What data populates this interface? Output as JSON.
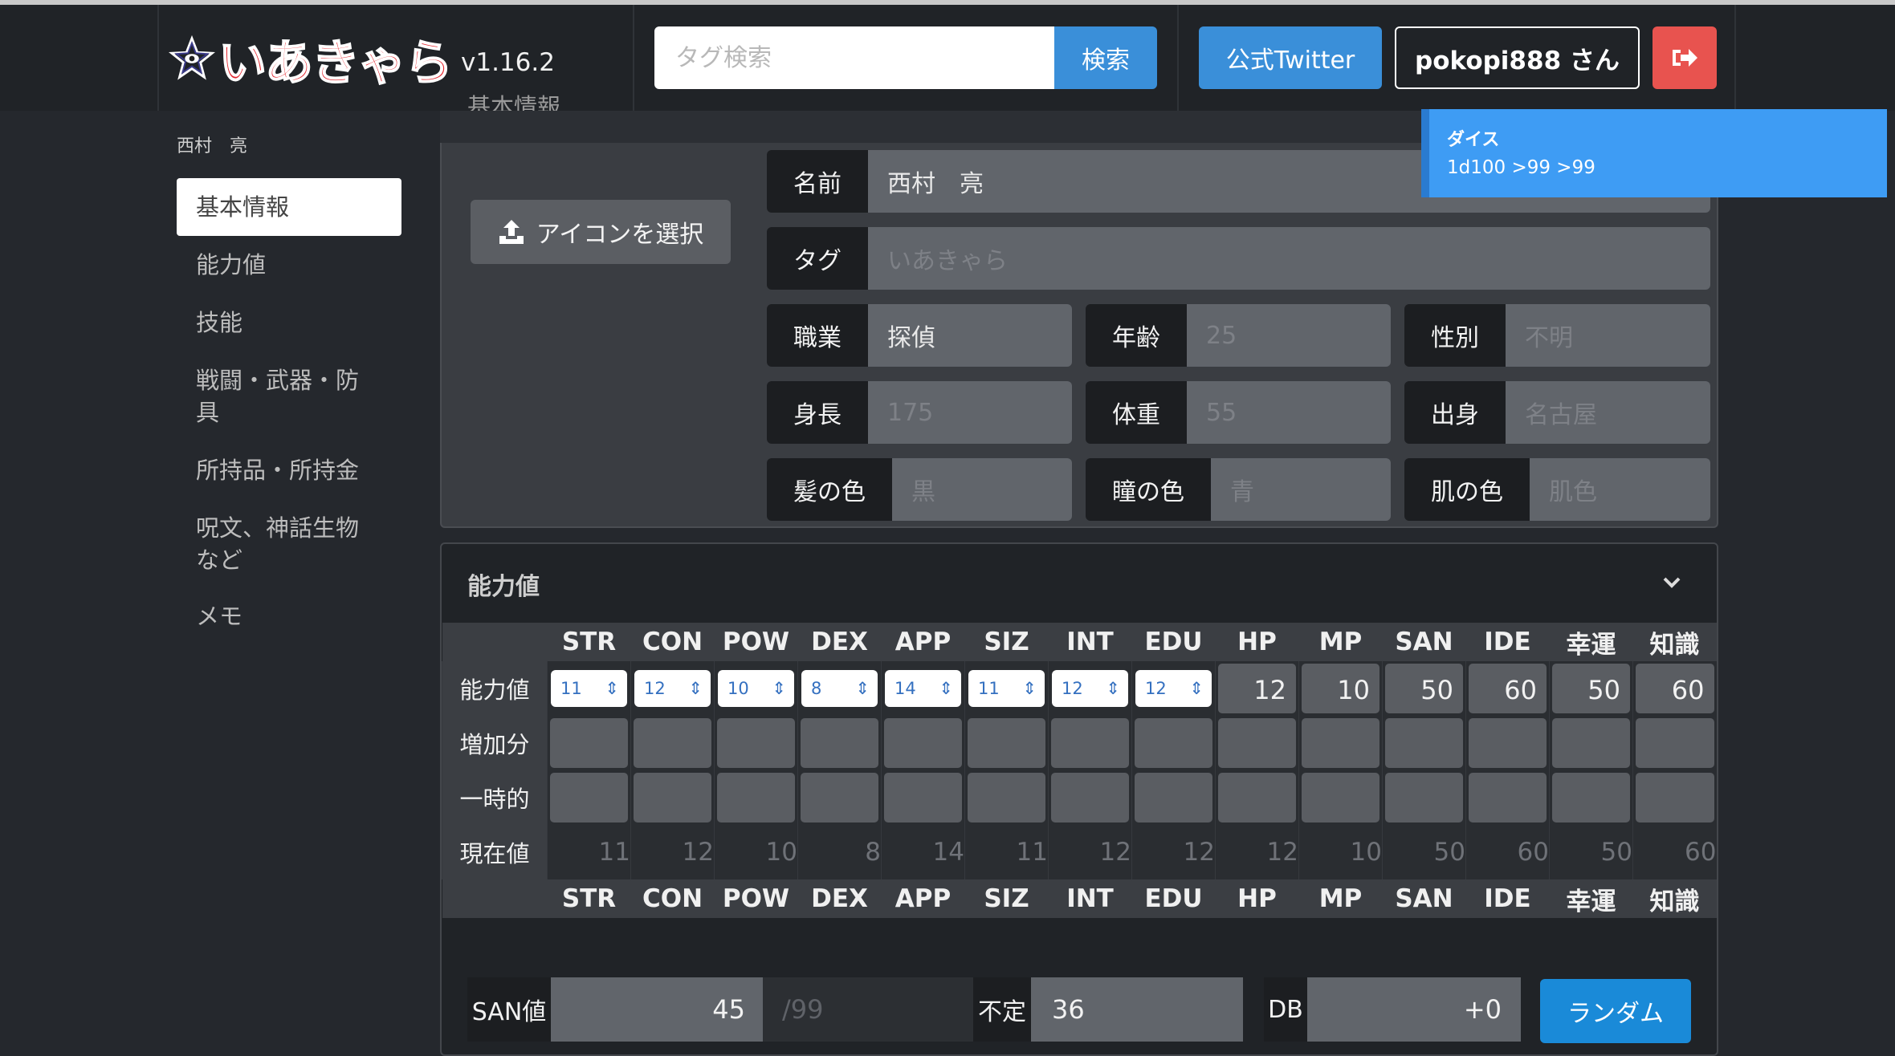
{
  "brand": {
    "name": "いあきゃら",
    "version": "v1.16.2"
  },
  "search": {
    "placeholder": "タグ検索",
    "button": "検索"
  },
  "header": {
    "twitter": "公式Twitter",
    "user": "pokopi888 さん"
  },
  "sidebar": {
    "character_name": "西村　亮",
    "items": [
      {
        "label": "基本情報"
      },
      {
        "label": "能力値"
      },
      {
        "label": "技能"
      },
      {
        "label": "戦闘・武器・防具"
      },
      {
        "label": "所持品・所持金"
      },
      {
        "label": "呪文、神話生物など"
      },
      {
        "label": "メモ"
      }
    ]
  },
  "basic": {
    "section_title": "基本情報",
    "upload_label": "アイコンを選択",
    "name": {
      "label": "名前",
      "value": "西村　亮"
    },
    "tag": {
      "label": "タグ",
      "placeholder": "いあきゃら"
    },
    "job": {
      "label": "職業",
      "value": "探偵"
    },
    "age": {
      "label": "年齢",
      "placeholder": "25"
    },
    "gender": {
      "label": "性別",
      "placeholder": "不明"
    },
    "height": {
      "label": "身長",
      "placeholder": "175"
    },
    "weight": {
      "label": "体重",
      "placeholder": "55"
    },
    "origin": {
      "label": "出身",
      "placeholder": "名古屋"
    },
    "hair": {
      "label": "髪の色",
      "placeholder": "黒"
    },
    "eye": {
      "label": "瞳の色",
      "placeholder": "青"
    },
    "skin": {
      "label": "肌の色",
      "placeholder": "肌色"
    }
  },
  "toast": {
    "title": "ダイス",
    "message": "1d100 >99 >99"
  },
  "stats": {
    "section_title": "能力値",
    "columns": [
      "STR",
      "CON",
      "POW",
      "DEX",
      "APP",
      "SIZ",
      "INT",
      "EDU",
      "HP",
      "MP",
      "SAN",
      "IDE",
      "幸運",
      "知識"
    ],
    "row_labels": {
      "base": "能力値",
      "plus": "増加分",
      "temp": "一時的",
      "current": "現在値"
    },
    "base_select": [
      "11",
      "12",
      "10",
      "8",
      "14",
      "11",
      "12",
      "12"
    ],
    "base_computed": [
      "12",
      "10",
      "50",
      "60",
      "50",
      "60"
    ],
    "current": [
      "11",
      "12",
      "10",
      "8",
      "14",
      "11",
      "12",
      "12",
      "12",
      "10",
      "50",
      "60",
      "50",
      "60"
    ]
  },
  "bottom": {
    "san_label": "SAN値",
    "san_value": "45",
    "san_max": "/99",
    "indef_label": "不定",
    "indef_value": "36",
    "db_label": "DB",
    "db_value": "+0",
    "random_button": "ランダム"
  }
}
